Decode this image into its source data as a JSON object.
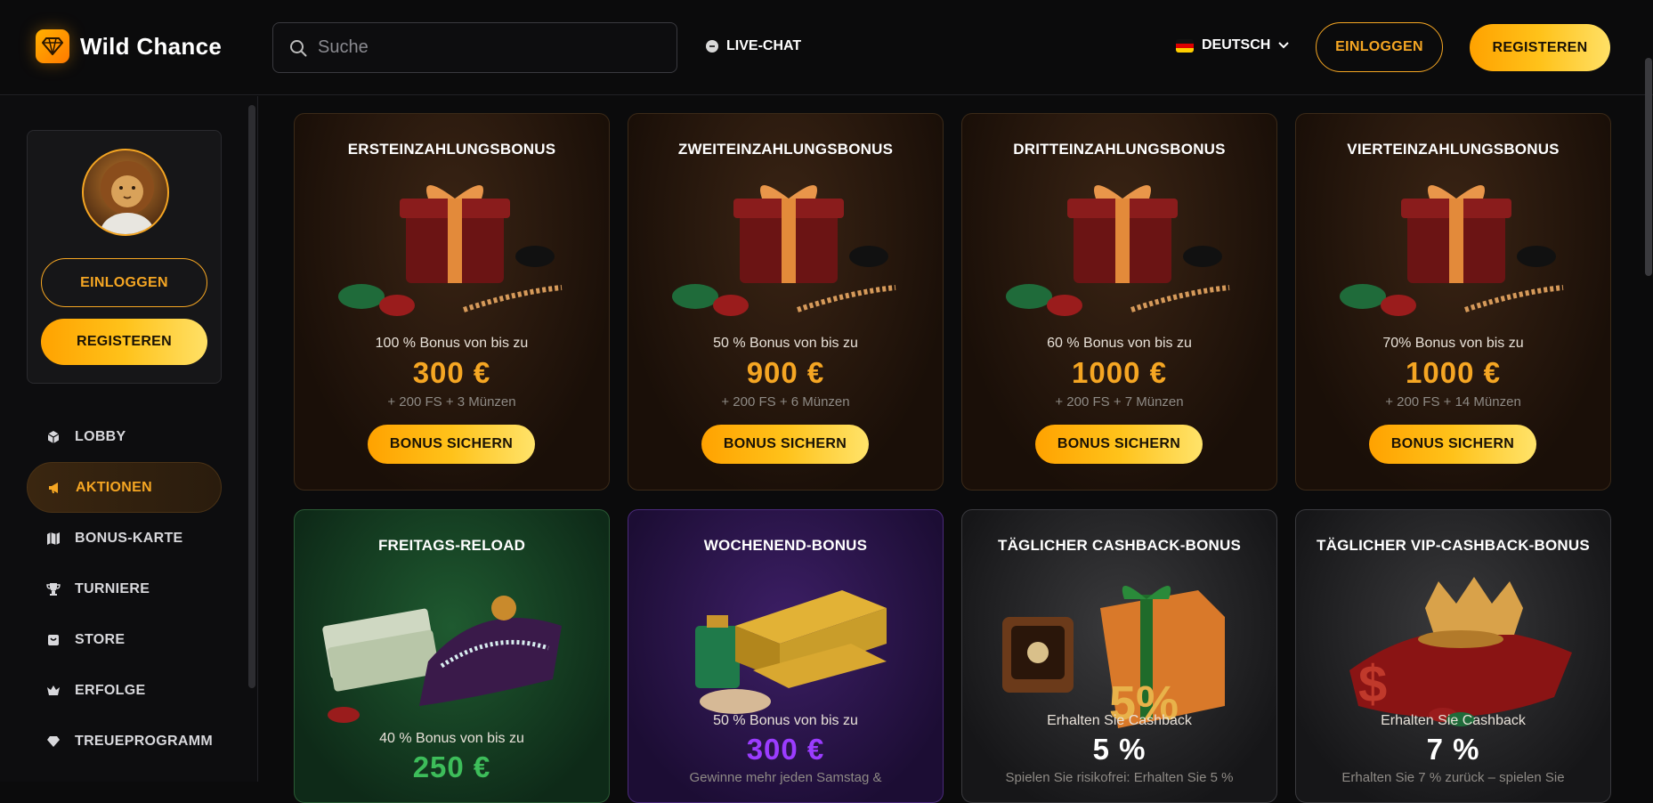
{
  "header": {
    "brand": "Wild Chance",
    "search_placeholder": "Suche",
    "livechat": "LIVE-CHAT",
    "language": "DEUTSCH",
    "login": "EINLOGGEN",
    "register": "REGISTEREN"
  },
  "sidebar": {
    "login": "EINLOGGEN",
    "register": "REGISTEREN",
    "items": [
      {
        "label": "LOBBY",
        "icon": "cube-icon"
      },
      {
        "label": "AKTIONEN",
        "icon": "megaphone-icon",
        "active": true
      },
      {
        "label": "BONUS-KARTE",
        "icon": "map-icon"
      },
      {
        "label": "TURNIERE",
        "icon": "trophy-icon"
      },
      {
        "label": "STORE",
        "icon": "store-icon"
      },
      {
        "label": "ERFOLGE",
        "icon": "crown-icon"
      },
      {
        "label": "TREUEPROGRAMM",
        "icon": "diamond-icon"
      }
    ]
  },
  "bonuses": [
    {
      "title": "ERSTEINZAHLUNGSBONUS",
      "sub": "100 % Bonus von bis zu",
      "amount": "300 €",
      "extra": "+ 200 FS + 3 Münzen",
      "button": "BONUS SICHERN"
    },
    {
      "title": "ZWEITEINZAHLUNGSBONUS",
      "sub": "50 % Bonus von bis zu",
      "amount": "900 €",
      "extra": "+ 200 FS + 6 Münzen",
      "button": "BONUS SICHERN"
    },
    {
      "title": "DRITTEINZAHLUNGSBONUS",
      "sub": "60 % Bonus von bis zu",
      "amount": "1000 €",
      "extra": "+ 200 FS + 7 Münzen",
      "button": "BONUS SICHERN"
    },
    {
      "title": "VIERTEINZAHLUNGSBONUS",
      "sub": "70% Bonus von bis zu",
      "amount": "1000 €",
      "extra": "+ 200 FS + 14 Münzen",
      "button": "BONUS SICHERN"
    }
  ],
  "promos": [
    {
      "title": "FREITAGS-RELOAD",
      "sub": "40 % Bonus von bis zu",
      "amount": "250 €"
    },
    {
      "title": "WOCHENEND-BONUS",
      "sub": "50 % Bonus von bis zu",
      "amount": "300 €",
      "extra": "Gewinne mehr jeden Samstag &"
    },
    {
      "title": "TÄGLICHER CASHBACK-BONUS",
      "sub": "Erhalten Sie Cashback",
      "amount": "5 %",
      "extra": "Spielen Sie risikofrei: Erhalten Sie 5 %",
      "badge": "5%"
    },
    {
      "title": "TÄGLICHER VIP-CASHBACK-BONUS",
      "sub": "Erhalten Sie Cashback",
      "amount": "7 %",
      "extra": "Erhalten Sie 7 % zurück – spielen Sie"
    }
  ],
  "colors": {
    "accent": "#f5a623",
    "green_amount": "#3dbd5a",
    "purple_amount": "#9b3cff"
  }
}
